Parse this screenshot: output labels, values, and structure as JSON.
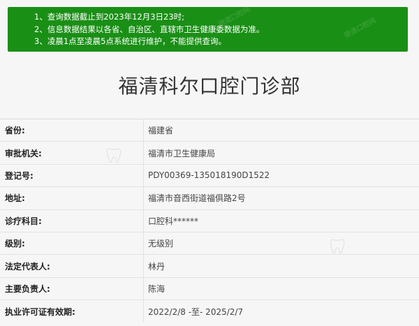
{
  "notice": {
    "lines": [
      "1、查询数据截止到2023年12月3日23时;",
      "2、信息数据结果以各省、自治区、直辖市卫生健康委数据为准。",
      "3、凌晨1点至凌晨5点系统进行维护，不能提供查询。"
    ]
  },
  "title": "福清科尔口腔门诊部",
  "rows": [
    {
      "label": "省份:",
      "value": "福建省"
    },
    {
      "label": "审批机关:",
      "value": "福清市卫生健康局"
    },
    {
      "label": "登记号:",
      "value": "PDY00369-135018190D1522"
    },
    {
      "label": "地址:",
      "value": "福清市音西街道福俱路2号"
    },
    {
      "label": "诊疗科目:",
      "value": "口腔科******"
    },
    {
      "label": "级别:",
      "value": "无级别"
    },
    {
      "label": "法定代表人:",
      "value": "林丹"
    },
    {
      "label": "主要负责人:",
      "value": "陈海"
    },
    {
      "label": "执业许可证有效期:",
      "value": "2022/2/8 -至- 2025/2/7"
    }
  ],
  "colors": {
    "notice_bg": "#1a8f16",
    "text": "#333333",
    "border": "#e2e2e2"
  },
  "watermark": {
    "text": "德道口腔网"
  }
}
